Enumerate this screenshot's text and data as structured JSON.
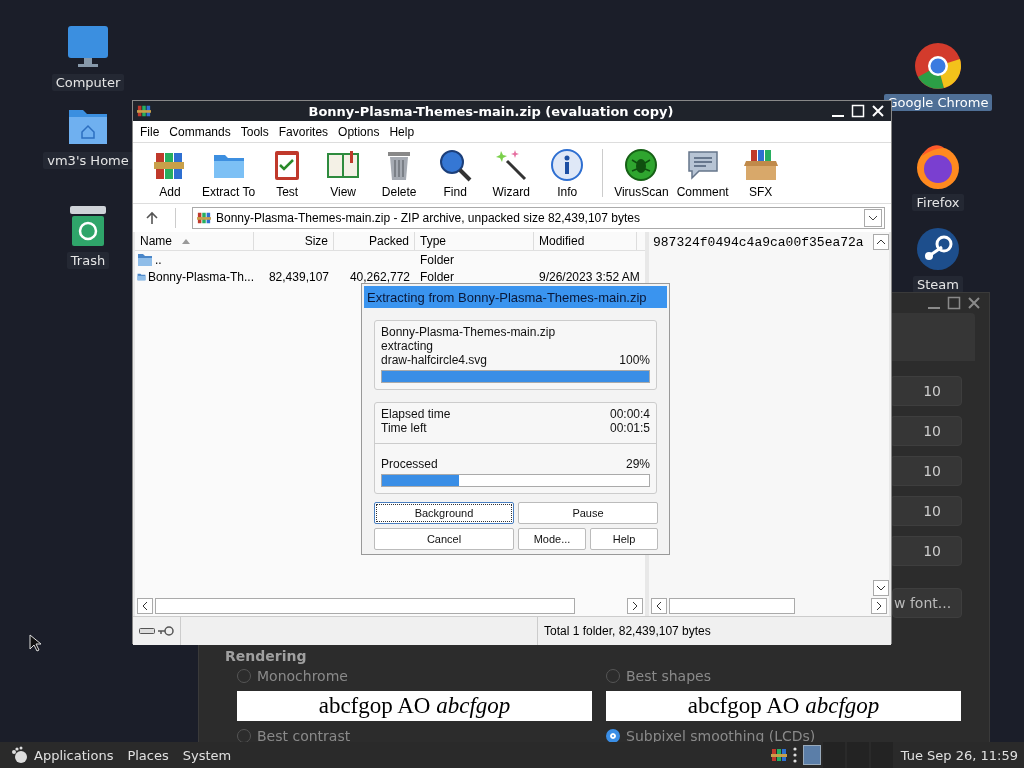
{
  "desktop_icons": [
    {
      "label": "Computer",
      "selected": false
    },
    {
      "label": "vm3's Home",
      "selected": false
    },
    {
      "label": "Trash",
      "selected": false
    },
    {
      "label": "Google Chrome",
      "selected": true
    },
    {
      "label": "Firefox",
      "selected": false
    },
    {
      "label": "Steam",
      "selected": false
    }
  ],
  "font_window": {
    "values": [
      "10",
      "10",
      "10",
      "10",
      "10"
    ],
    "button": "w font...",
    "section": "Rendering",
    "options": [
      {
        "label": "Monochrome",
        "selected": false
      },
      {
        "label": "Best shapes",
        "selected": false
      },
      {
        "label": "Best contrast",
        "selected": false
      },
      {
        "label": "Subpixel smoothing (LCDs)",
        "selected": true
      }
    ],
    "previews": [
      "abcfgop AO *abcfgop*",
      "abcfgop AO *abcfgop*"
    ]
  },
  "archive_window": {
    "title": "Bonny-Plasma-Themes-main.zip (evaluation copy)",
    "menu": [
      "File",
      "Commands",
      "Tools",
      "Favorites",
      "Options",
      "Help"
    ],
    "toolbar": [
      "Add",
      "Extract To",
      "Test",
      "View",
      "Delete",
      "Find",
      "Wizard",
      "Info",
      "VirusScan",
      "Comment",
      "SFX"
    ],
    "address": "Bonny-Plasma-Themes-main.zip - ZIP archive, unpacked size 82,439,107 bytes",
    "columns": [
      "Name",
      "Size",
      "Packed",
      "Type",
      "Modified"
    ],
    "rows": [
      {
        "name": "..",
        "type": "Folder"
      },
      {
        "name": "Bonny-Plasma-Th...",
        "size": "82,439,107",
        "packed": "40,262,772",
        "type": "Folder",
        "modified": "9/26/2023 3:52 AM"
      }
    ],
    "comment": "987324f0494c4a9ca00f35ea72a",
    "status": "Total 1 folder, 82,439,107 bytes"
  },
  "progress_dialog": {
    "title": "Extracting from Bonny-Plasma-Themes-main.zip",
    "archive": "Bonny-Plasma-Themes-main.zip",
    "action": "extracting",
    "file": "draw-halfcircle4.svg",
    "file_percent": "100%",
    "file_bar": {
      "level": 1.0
    },
    "elapsed_label": "Elapsed time",
    "elapsed": "00:00:4",
    "left_label": "Time left",
    "left": "00:01:5",
    "processed_label": "Processed",
    "processed_percent": "29%",
    "processed_bar": {
      "level": 0.29
    },
    "buttons": [
      {
        "label": "Background",
        "focused": true
      },
      {
        "label": "Pause",
        "focused": false
      },
      {
        "label": "Cancel",
        "focused": false
      },
      {
        "label": "Mode...",
        "focused": false
      },
      {
        "label": "Help",
        "focused": false
      }
    ]
  },
  "taskbar": {
    "menus": [
      "Applications",
      "Places",
      "System"
    ],
    "clock": "Tue Sep 26, 11:59"
  }
}
